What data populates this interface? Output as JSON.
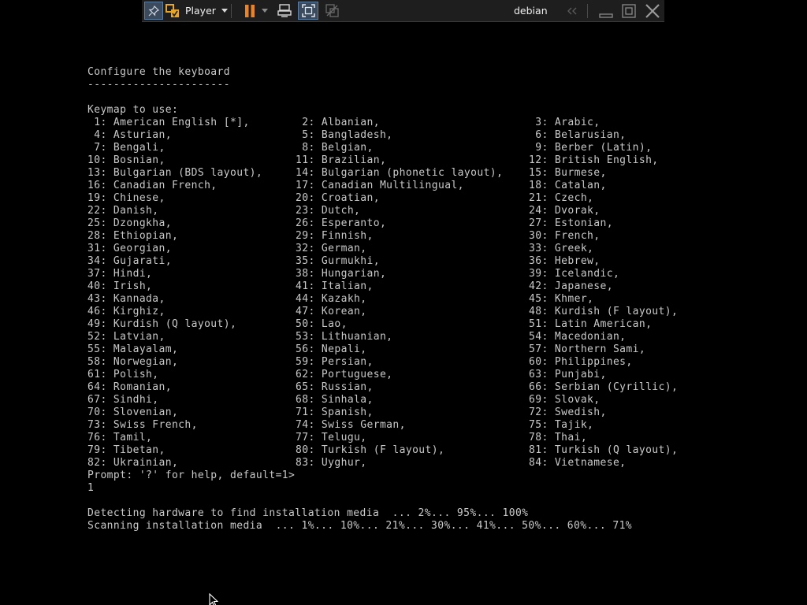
{
  "toolbar": {
    "player_label": "Player",
    "vm_name": "debian",
    "icons": [
      "pin-icon",
      "vmware-logo-icon",
      "dropdown-arrow-icon",
      "pause-icon",
      "send-ctrl-alt-del-icon",
      "fullscreen-icon",
      "unity-icon",
      "collapse-icon",
      "minimize-icon",
      "restore-icon",
      "close-icon"
    ],
    "accent_color": "#e8832a"
  },
  "console": {
    "title": "Configure the keyboard",
    "underline": "----------------------",
    "keymap_label": "Keymap to use:",
    "rows": [
      [
        " 1: American English [*],",
        " 2: Albanian,",
        " 3: Arabic,"
      ],
      [
        " 4: Asturian,",
        " 5: Bangladesh,",
        " 6: Belarusian,"
      ],
      [
        " 7: Bengali,",
        " 8: Belgian,",
        " 9: Berber (Latin),"
      ],
      [
        "10: Bosnian,",
        "11: Brazilian,",
        "12: British English,"
      ],
      [
        "13: Bulgarian (BDS layout),",
        "14: Bulgarian (phonetic layout),",
        "15: Burmese,"
      ],
      [
        "16: Canadian French,",
        "17: Canadian Multilingual,",
        "18: Catalan,"
      ],
      [
        "19: Chinese,",
        "20: Croatian,",
        "21: Czech,"
      ],
      [
        "22: Danish,",
        "23: Dutch,",
        "24: Dvorak,"
      ],
      [
        "25: Dzongkha,",
        "26: Esperanto,",
        "27: Estonian,"
      ],
      [
        "28: Ethiopian,",
        "29: Finnish,",
        "30: French,"
      ],
      [
        "31: Georgian,",
        "32: German,",
        "33: Greek,"
      ],
      [
        "34: Gujarati,",
        "35: Gurmukhi,",
        "36: Hebrew,"
      ],
      [
        "37: Hindi,",
        "38: Hungarian,",
        "39: Icelandic,"
      ],
      [
        "40: Irish,",
        "41: Italian,",
        "42: Japanese,"
      ],
      [
        "43: Kannada,",
        "44: Kazakh,",
        "45: Khmer,"
      ],
      [
        "46: Kirghiz,",
        "47: Korean,",
        "48: Kurdish (F layout),"
      ],
      [
        "49: Kurdish (Q layout),",
        "50: Lao,",
        "51: Latin American,"
      ],
      [
        "52: Latvian,",
        "53: Lithuanian,",
        "54: Macedonian,"
      ],
      [
        "55: Malayalam,",
        "56: Nepali,",
        "57: Northern Sami,"
      ],
      [
        "58: Norwegian,",
        "59: Persian,",
        "60: Philippines,"
      ],
      [
        "61: Polish,",
        "62: Portuguese,",
        "63: Punjabi,"
      ],
      [
        "64: Romanian,",
        "65: Russian,",
        "66: Serbian (Cyrillic),"
      ],
      [
        "67: Sindhi,",
        "68: Sinhala,",
        "69: Slovak,"
      ],
      [
        "70: Slovenian,",
        "71: Spanish,",
        "72: Swedish,"
      ],
      [
        "73: Swiss French,",
        "74: Swiss German,",
        "75: Tajik,"
      ],
      [
        "76: Tamil,",
        "77: Telugu,",
        "78: Thai,"
      ],
      [
        "79: Tibetan,",
        "80: Turkish (F layout),",
        "81: Turkish (Q layout),"
      ],
      [
        "82: Ukrainian,",
        "83: Uyghur,",
        "84: Vietnamese,"
      ]
    ],
    "prompt": "Prompt: '?' for help, default=1>",
    "answer": "1",
    "detect_line": "Detecting hardware to find installation media  ... 2%... 95%... 100%",
    "scan_line": "Scanning installation media  ... 1%... 10%... 21%... 30%... 41%... 50%... 60%... 71%",
    "text_color": "#c9c9c9",
    "background_color": "#000000"
  }
}
